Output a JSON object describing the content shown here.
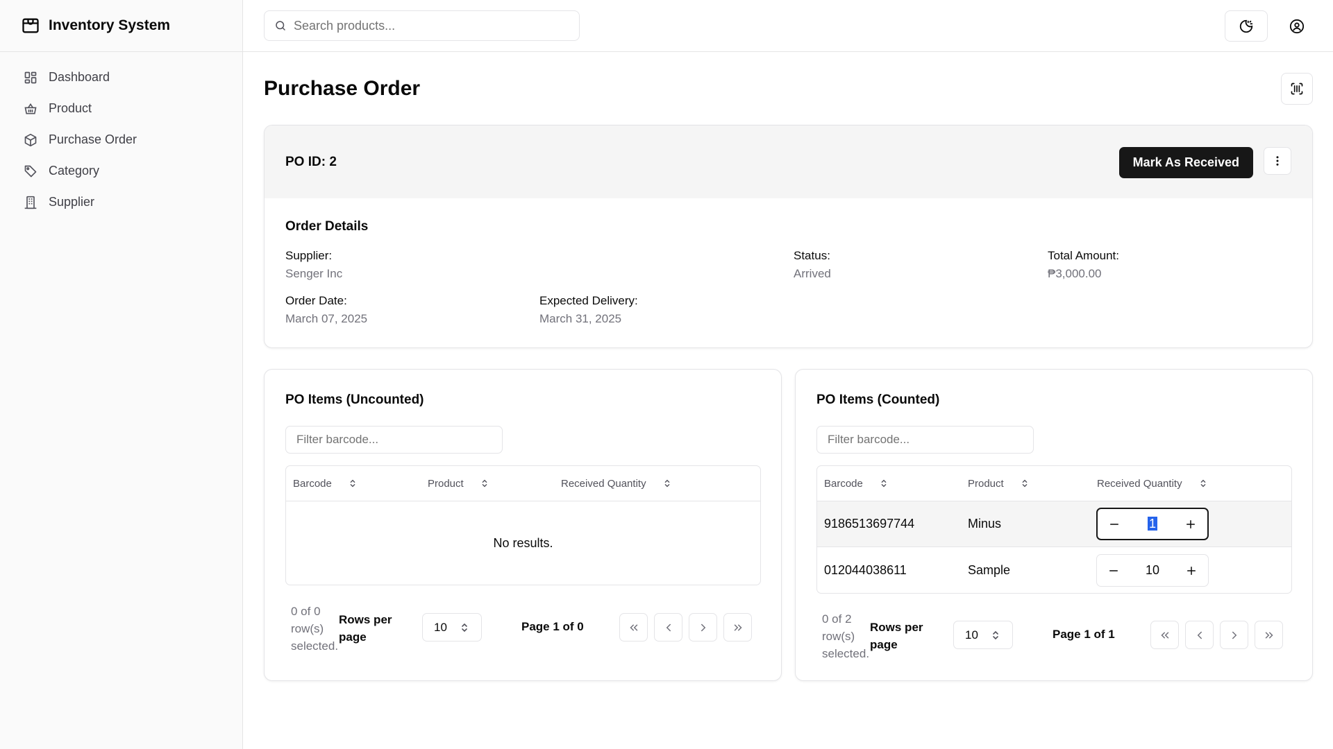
{
  "app": {
    "title": "Inventory System"
  },
  "sidebar": {
    "items": [
      {
        "label": "Dashboard",
        "icon": "dashboard-icon"
      },
      {
        "label": "Product",
        "icon": "basket-icon"
      },
      {
        "label": "Purchase Order",
        "icon": "package-icon"
      },
      {
        "label": "Category",
        "icon": "tag-icon"
      },
      {
        "label": "Supplier",
        "icon": "building-icon"
      }
    ]
  },
  "header": {
    "search_placeholder": "Search products..."
  },
  "page": {
    "title": "Purchase Order"
  },
  "po": {
    "id_label": "PO ID: 2",
    "mark_received_label": "Mark As Received",
    "order_details_title": "Order Details",
    "fields": {
      "supplier_label": "Supplier:",
      "supplier_value": "Senger Inc",
      "status_label": "Status:",
      "status_value": "Arrived",
      "total_label": "Total Amount:",
      "total_value": "₱3,000.00",
      "order_date_label": "Order Date:",
      "order_date_value": "March 07, 2025",
      "expected_label": "Expected Delivery:",
      "expected_value": "March 31, 2025"
    }
  },
  "uncounted": {
    "title": "PO Items (Uncounted)",
    "filter_placeholder": "Filter barcode...",
    "columns": [
      "Barcode",
      "Product",
      "Received Quantity"
    ],
    "empty_text": "No results.",
    "pager": {
      "selected_text": "0 of 0 row(s) selected.",
      "rows_per_page_label": "Rows per page",
      "rows_per_page_value": "10",
      "page_label": "Page 1 of 0"
    }
  },
  "counted": {
    "title": "PO Items (Counted)",
    "filter_placeholder": "Filter barcode...",
    "columns": [
      "Barcode",
      "Product",
      "Received Quantity"
    ],
    "rows": [
      {
        "barcode": "9186513697744",
        "product": "Minus",
        "quantity": "1"
      },
      {
        "barcode": "012044038611",
        "product": "Sample",
        "quantity": "10"
      }
    ],
    "pager": {
      "selected_text": "0 of 2 row(s) selected.",
      "rows_per_page_label": "Rows per page",
      "rows_per_page_value": "10",
      "page_label": "Page 1 of 1"
    }
  },
  "colors": {
    "primary_button": "#171717",
    "muted_text": "#71717a",
    "border": "#e4e4e7",
    "sidebar_bg": "#fafafa",
    "selection": "#2563eb"
  }
}
